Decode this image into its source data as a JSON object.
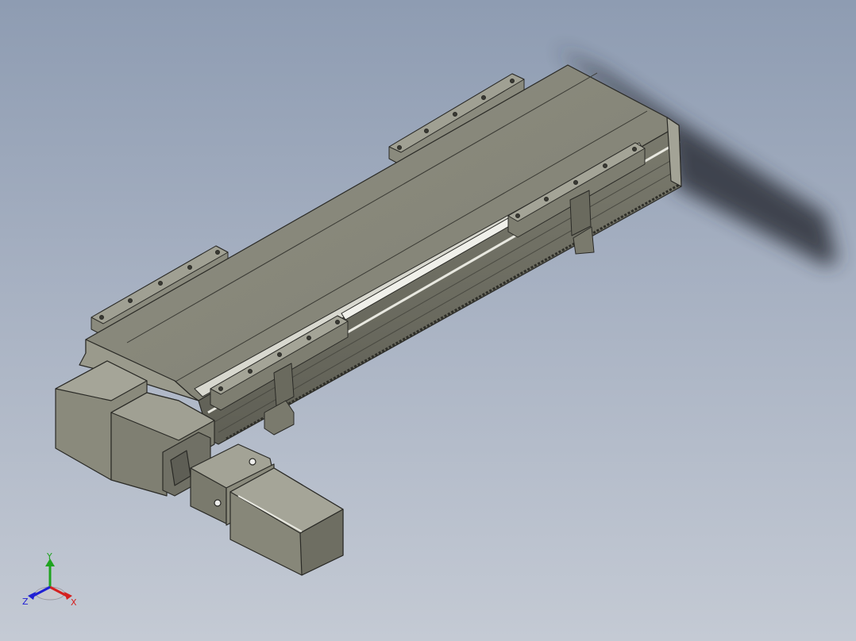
{
  "viewport": {
    "background_top": "#8e9cb2",
    "background_bottom": "#c4cad4"
  },
  "model": {
    "body_color": "#878779",
    "body_dark": "#6e6e62",
    "body_light": "#a3a396",
    "edge_color": "#2a2a26"
  },
  "triad": {
    "x_label": "X",
    "y_label": "Y",
    "z_label": "Z",
    "x_color": "#d42020",
    "y_color": "#1fa31f",
    "z_color": "#2020d4"
  }
}
